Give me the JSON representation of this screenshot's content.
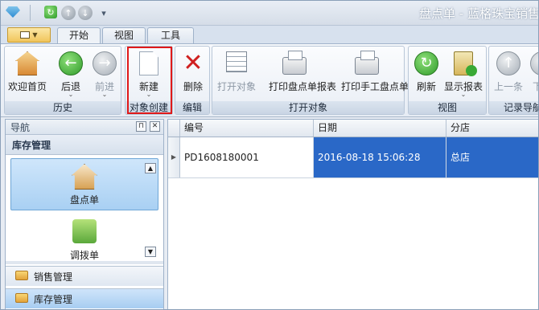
{
  "window": {
    "title": "盘点单 - 蓝格珠宝销售"
  },
  "tabs": [
    {
      "label": "开始"
    },
    {
      "label": "视图"
    },
    {
      "label": "工具"
    }
  ],
  "ribbon": {
    "groups": {
      "history": {
        "label": "历史",
        "home": "欢迎首页",
        "back": "后退",
        "forward": "前进"
      },
      "create": {
        "label": "对象创建",
        "new": "新建"
      },
      "edit": {
        "label": "编辑",
        "delete": "删除"
      },
      "open": {
        "label": "打开对象",
        "open_object": "打开对象",
        "print_report": "打印盘点单报表",
        "print_manual": "打印手工盘点单"
      },
      "view": {
        "label": "视图",
        "refresh": "刷新",
        "show_report": "显示报表"
      },
      "nav": {
        "label": "记录导航",
        "prev": "上一条",
        "next": "下一"
      }
    },
    "icons": {
      "home": "home-icon",
      "back": "arrow-left-icon",
      "forward": "arrow-right-icon",
      "new": "new-document-icon",
      "delete": "delete-x-icon",
      "open_object": "open-object-icon",
      "printer": "printer-icon",
      "refresh": "refresh-icon",
      "report": "report-icon"
    }
  },
  "nav_panel": {
    "title": "导航",
    "section": "库存管理",
    "items": [
      {
        "label": "盘点单",
        "icon": "house-icon",
        "selected": true
      },
      {
        "label": "调拨单",
        "icon": "puzzle-icon",
        "selected": false
      }
    ],
    "groups": [
      {
        "label": "销售管理",
        "icon": "folder-icon",
        "active": false
      },
      {
        "label": "库存管理",
        "icon": "folder-icon",
        "active": true
      }
    ]
  },
  "grid": {
    "columns": [
      "编号",
      "日期",
      "分店"
    ],
    "rows": [
      {
        "code": "PD1608180001",
        "date": "2016-08-18 15:06:28",
        "branch": "总店"
      }
    ]
  },
  "colors": {
    "selection": "#2a68c7",
    "highlight_box": "#e01919"
  }
}
